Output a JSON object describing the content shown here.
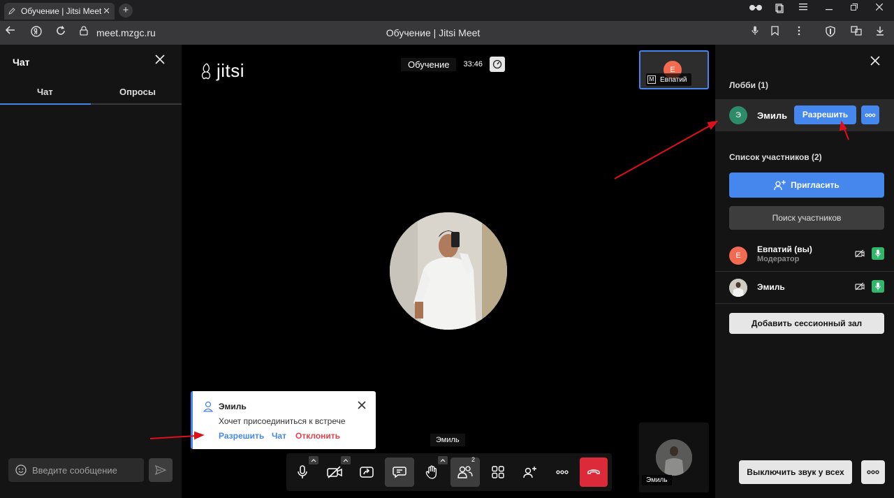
{
  "browser": {
    "tab_title": "Обучение | Jitsi Meet",
    "tab_close": "✕",
    "new_tab": "+",
    "url": "meet.mzgc.ru",
    "page_title": "Обучение | Jitsi Meet"
  },
  "chat": {
    "title": "Чат",
    "tabs": [
      "Чат",
      "Опросы"
    ],
    "input_placeholder": "Введите сообщение"
  },
  "stage": {
    "logo_text": "jitsi",
    "conference_name": "Обучение",
    "timer": "33:46",
    "thumb_top": {
      "initial": "Е",
      "name": "Евпатий",
      "moderator_badge": "M"
    },
    "thumb_bottom": {
      "name": "Эмиль"
    },
    "tooltip": "Эмиль"
  },
  "notification": {
    "title": "Эмиль",
    "message": "Хочет присоединиться к встрече",
    "actions": {
      "allow": "Разрешить",
      "chat": "Чат",
      "reject": "Отклонить"
    },
    "colors": {
      "allow": "#4687ed",
      "chat": "#4687ed",
      "reject": "#e0434d"
    }
  },
  "toolbar": {
    "participants_count": "2",
    "buttons": [
      "microphone",
      "camera",
      "screen-share",
      "chat",
      "raise-hand",
      "participants",
      "tile-view",
      "invite",
      "more",
      "hangup"
    ],
    "hangup_color": "#dd2a3a"
  },
  "participants": {
    "lobby_title": "Лобби (1)",
    "lobby_participant": {
      "initial": "Э",
      "name": "Эмиль",
      "allow_label": "Разрешить"
    },
    "list_title": "Список участников (2)",
    "invite_label": "Пригласить",
    "search_label": "Поиск участников",
    "members": [
      {
        "initial": "Е",
        "name": "Евпатий (вы)",
        "role": "Модератор"
      },
      {
        "name": "Эмиль"
      }
    ],
    "breakout_label": "Добавить сессионный зал",
    "mute_all_label": "Выключить звук у всех"
  },
  "colors": {
    "accent": "#4687ed",
    "mic_on": "#31b76a",
    "avatar_orange": "#f26b50",
    "avatar_green": "#2e8b6a",
    "annotation_arrow": "#e0101a"
  }
}
